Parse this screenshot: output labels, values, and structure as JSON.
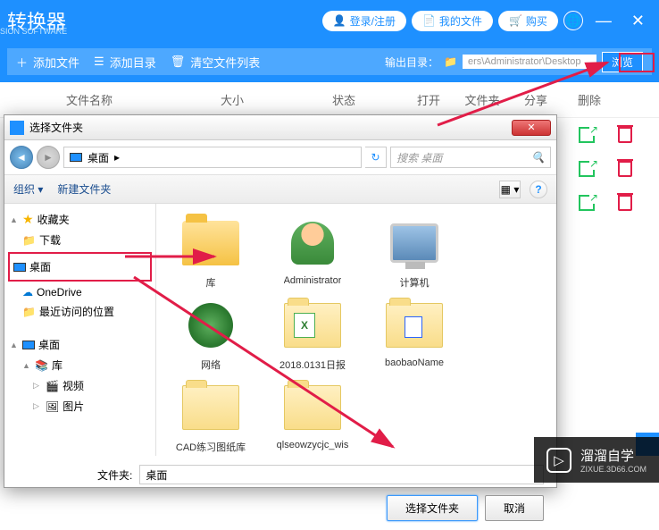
{
  "header": {
    "title": "转换器",
    "subtitle": "SION SOFTWARE",
    "login": "登录/注册",
    "my_files": "我的文件",
    "buy": "购买"
  },
  "toolbar": {
    "add_file": "添加文件",
    "add_dir": "添加目录",
    "clear_list": "清空文件列表",
    "output_dir_label": "输出目录：",
    "output_path": "ers\\Administrator\\Desktop",
    "browse": "浏览"
  },
  "columns": {
    "name": "文件名称",
    "size": "大小",
    "status": "状态",
    "open": "打开",
    "folder": "文件夹",
    "share": "分享",
    "delete": "删除"
  },
  "dialog": {
    "title": "选择文件夹",
    "breadcrumb_location": "桌面",
    "search_placeholder": "搜索 桌面",
    "organize": "组织",
    "new_folder": "新建文件夹",
    "folder_label": "文件夹:",
    "folder_value": "桌面",
    "select_btn": "选择文件夹",
    "cancel_btn": "取消"
  },
  "tree": {
    "favorites": "收藏夹",
    "downloads": "下载",
    "desktop": "桌面",
    "onedrive": "OneDrive",
    "recent": "最近访问的位置",
    "desktop2": "桌面",
    "library": "库",
    "videos": "视频",
    "pictures": "图片"
  },
  "files": {
    "library": "库",
    "admin": "Administrator",
    "computer": "计算机",
    "network": "网络",
    "f1": "2018.0131日报",
    "f2": "baobaoName",
    "f3": "CAD练习图纸库",
    "f4": "qlseowzycjc_wis"
  },
  "watermark": {
    "name": "溜溜自学",
    "url": "ZIXUE.3D66.COM"
  }
}
